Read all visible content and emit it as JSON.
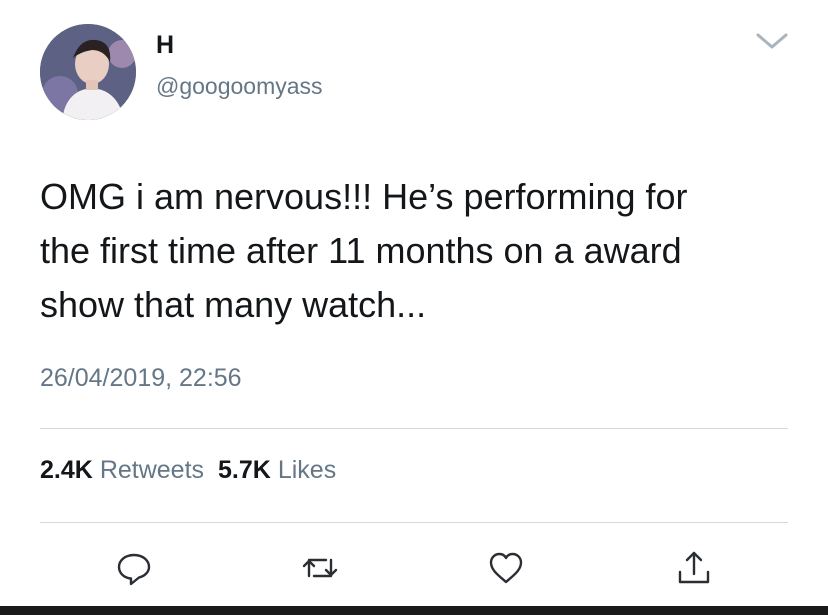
{
  "author": {
    "display_name": "H",
    "handle": "@googoomyass"
  },
  "tweet": {
    "text": "OMG i am nervous!!! He’s performing for\nthe first time after 11 months on a award\nshow that many watch...",
    "timestamp": "26/04/2019, 22:56"
  },
  "stats": {
    "retweets_count": "2.4K",
    "retweets_label": "Retweets",
    "likes_count": "5.7K",
    "likes_label": "Likes"
  },
  "icons": {
    "menu": "chevron-down-icon",
    "reply": "reply-icon",
    "retweet": "retweet-icon",
    "like": "heart-icon",
    "share": "share-icon"
  },
  "colors": {
    "text_primary": "#14171a",
    "text_secondary": "#657786",
    "divider": "#d4d9de"
  }
}
